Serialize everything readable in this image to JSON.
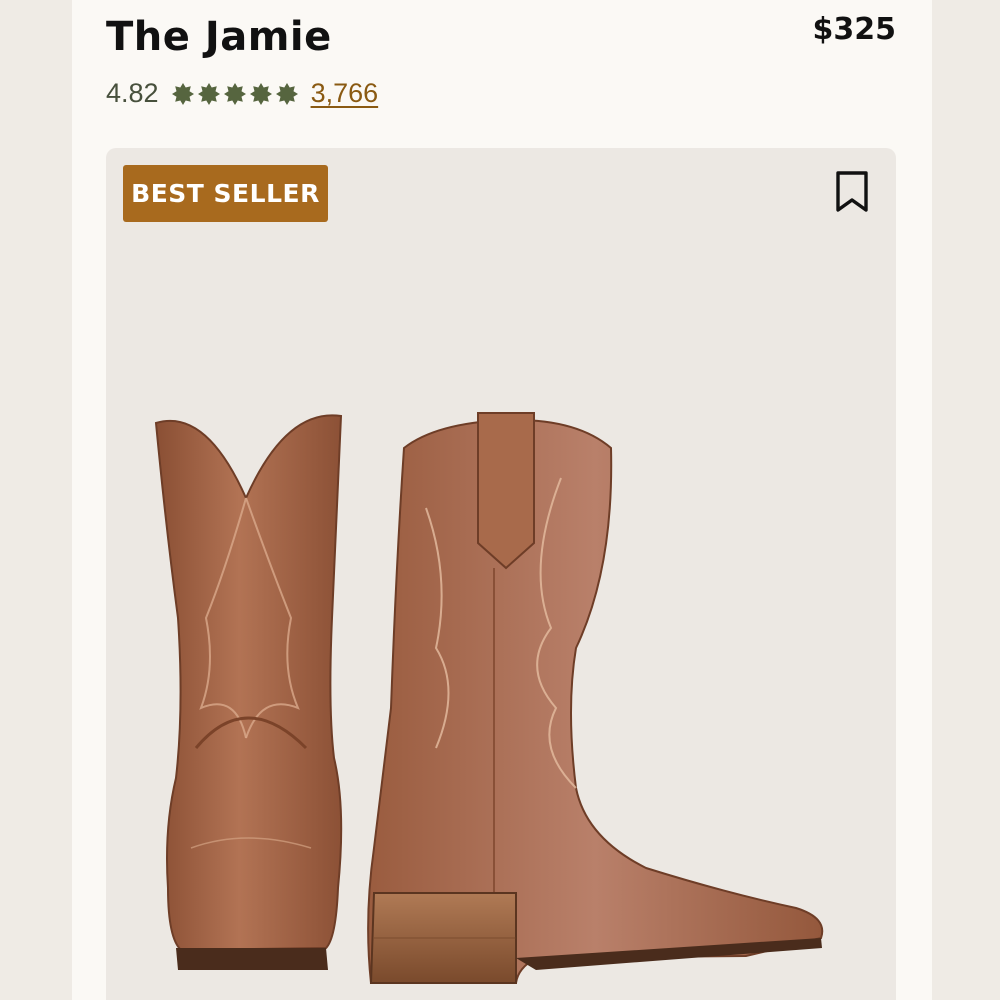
{
  "product": {
    "title": "The Jamie",
    "price": "$325",
    "rating": "4.82",
    "star_count": 5,
    "review_count": "3,766",
    "badge": "BEST SELLER"
  },
  "icons": {
    "star": "star-icon",
    "bookmark": "bookmark-icon"
  },
  "colors": {
    "rating_text": "#47503c",
    "star": "#56653f",
    "review_link": "#8a5a12",
    "badge_bg": "#a86a1e",
    "boot_leather": "#a9694a"
  }
}
